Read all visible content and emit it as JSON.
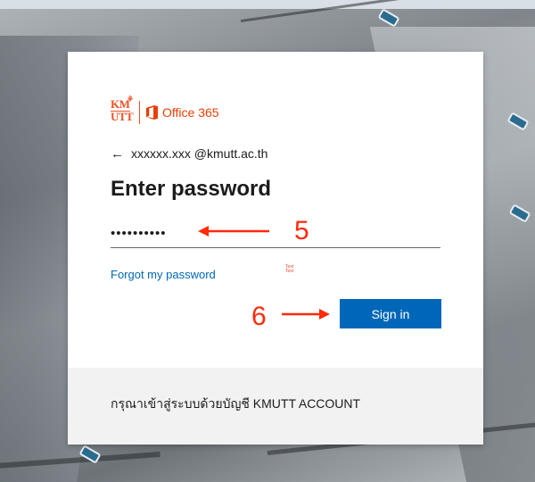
{
  "brand": {
    "logo_top": "KM",
    "logo_bottom": "UTT",
    "office_text": "Office 365",
    "accent": "#eb3c00"
  },
  "login": {
    "back_icon": "arrow-left-icon",
    "account": "xxxxxx.xxx @kmutt.ac.th",
    "title": "Enter password",
    "password_value": "••••••••••",
    "forgot_link": "Forgot my password",
    "signin_label": "Sign in",
    "primary_color": "#0067b8"
  },
  "footer": {
    "text": "กรุณาเข้าสู่ระบบด้วยบัญชี KMUTT ACCOUNT"
  },
  "annotations": {
    "step_password": "5",
    "step_signin": "6",
    "color": "#ff2a0a"
  }
}
